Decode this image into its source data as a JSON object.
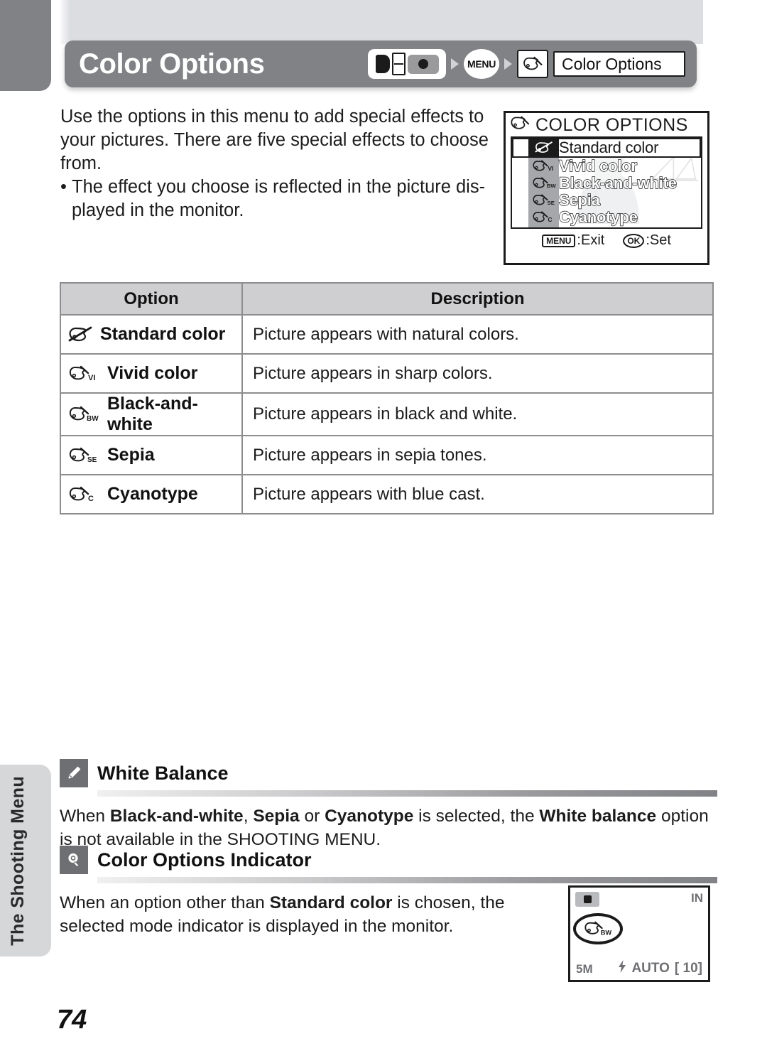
{
  "header": {
    "title": "Color Options",
    "breadcrumb": {
      "mode_icon": "shooting-mode-icon",
      "menu_button_label": "MENU",
      "options_icon": "color-options-icon",
      "crumb_label": "Color Options"
    }
  },
  "intro": {
    "paragraph": "Use the options in this menu to add special effects to your pictures. There are five special effects to choose from.",
    "bullet_mark": "•",
    "bullet": "The effect you choose is reflected in the picture dis-played in the monitor."
  },
  "lcd": {
    "title": "COLOR OPTIONS",
    "check_mark": "✓",
    "items": [
      {
        "label": "Standard color",
        "icon": "palette-slashed-icon",
        "suffix": "",
        "selected": true
      },
      {
        "label": "Vivid color",
        "icon": "palette-icon",
        "suffix": "VI",
        "selected": false
      },
      {
        "label": "Black-and-white",
        "icon": "palette-icon",
        "suffix": "BW",
        "selected": false
      },
      {
        "label": "Sepia",
        "icon": "palette-icon",
        "suffix": "SE",
        "selected": false
      },
      {
        "label": "Cyanotype",
        "icon": "palette-icon",
        "suffix": "C",
        "selected": false
      }
    ],
    "footer": {
      "exit_key": "MENU",
      "exit_label": ":Exit",
      "set_key": "OK",
      "set_label": ":Set"
    }
  },
  "table": {
    "headers": [
      "Option",
      "Description"
    ],
    "rows": [
      {
        "icon": "palette-slashed-icon",
        "suffix": "",
        "option": "Standard color",
        "description": "Picture appears with natural colors."
      },
      {
        "icon": "palette-icon",
        "suffix": "VI",
        "option": "Vivid color",
        "description": "Picture appears in sharp colors."
      },
      {
        "icon": "palette-icon",
        "suffix": "BW",
        "option": "Black-and-white",
        "description": "Picture appears in black and white."
      },
      {
        "icon": "palette-icon",
        "suffix": "SE",
        "option": "Sepia",
        "description": "Picture appears in sepia tones."
      },
      {
        "icon": "palette-icon",
        "suffix": "C",
        "option": "Cyanotype",
        "description": "Picture appears with blue cast."
      }
    ]
  },
  "notes": [
    {
      "badge_icon": "pencil-icon",
      "title": "White Balance",
      "body_segments": [
        {
          "text": "When ",
          "bold": false
        },
        {
          "text": "Black-and-white",
          "bold": true
        },
        {
          "text": ", ",
          "bold": false
        },
        {
          "text": "Sepia",
          "bold": true
        },
        {
          "text": " or ",
          "bold": false
        },
        {
          "text": "Cyanotype",
          "bold": true
        },
        {
          "text": " is selected, the ",
          "bold": false
        },
        {
          "text": "White balance",
          "bold": true
        },
        {
          "text": " option is not available in the SHOOTING MENU.",
          "bold": false
        }
      ]
    },
    {
      "badge_icon": "lightbulb-icon",
      "title": "Color Options Indicator",
      "body_segments": [
        {
          "text": "When an option other than ",
          "bold": false
        },
        {
          "text": "Standard color",
          "bold": true
        },
        {
          "text": " is chosen, the selected mode indicator is displayed in the monitor.",
          "bold": false
        }
      ]
    }
  ],
  "monitor": {
    "mode_icon": "camera-mode-icon",
    "memory_indicator": "IN",
    "color_indicator": "palette-bw-icon",
    "image_size": "5M",
    "flash_icon": "flash-icon",
    "flash_mode": "AUTO",
    "frames_remaining": "10"
  },
  "side_tab": {
    "label": "The Shooting Menu"
  },
  "page_number": "74"
}
